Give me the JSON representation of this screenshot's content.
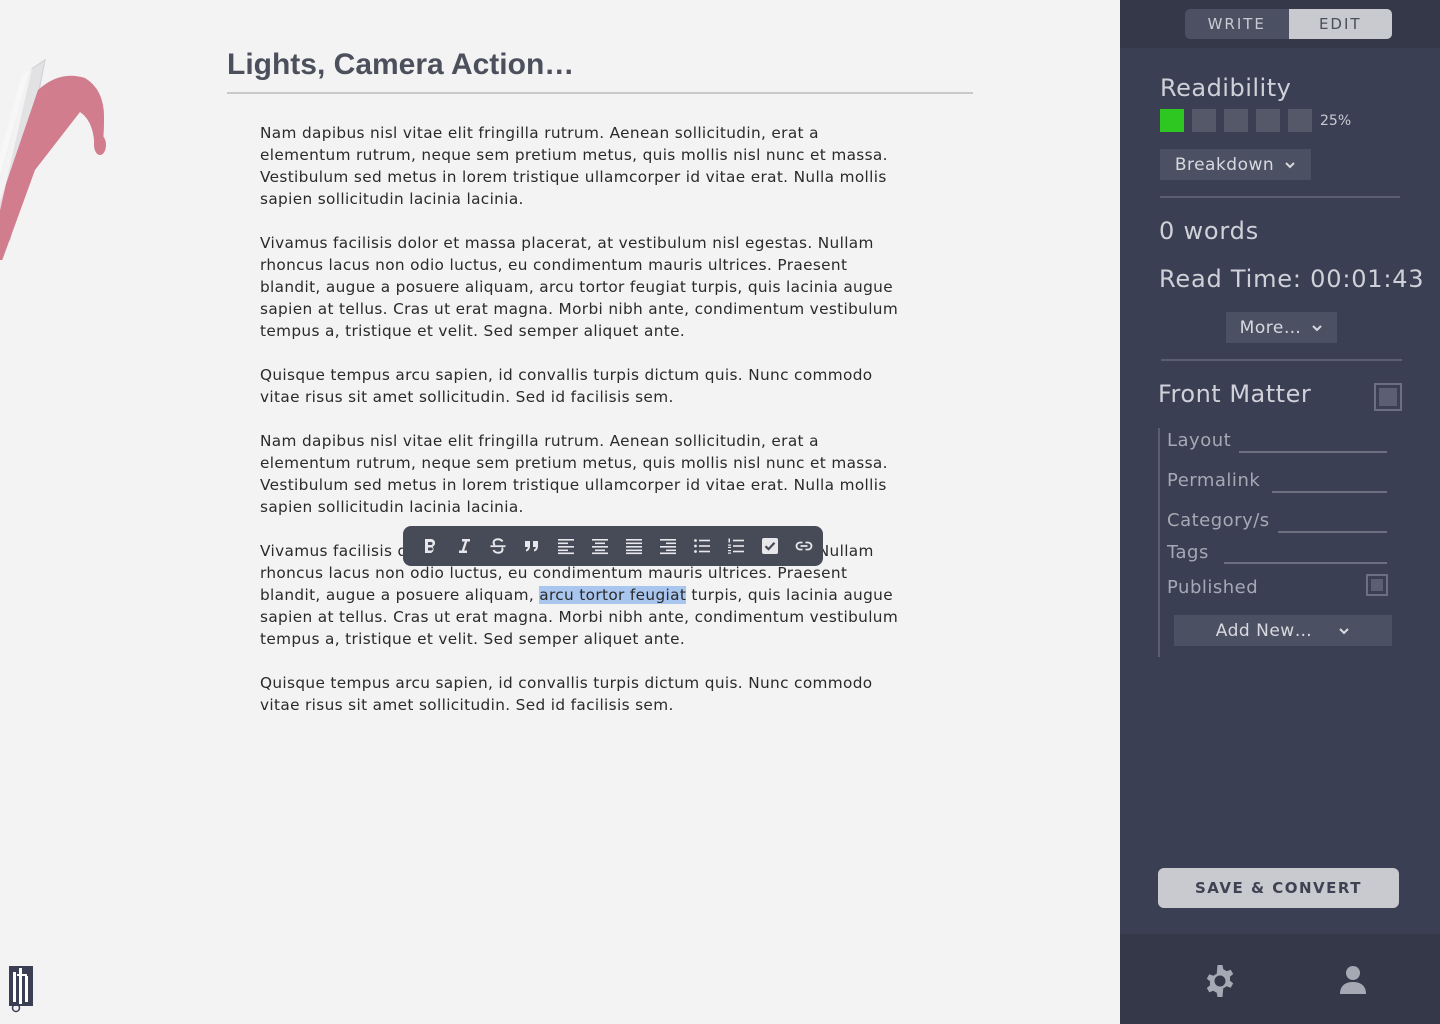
{
  "document": {
    "title": "Lights, Camera Action…",
    "paragraphs": [
      "Nam dapibus nisl vitae elit fringilla rutrum. Aenean sollicitudin, erat a elementum rutrum, neque sem pretium metus, quis mollis nisl nunc et massa. Vestibulum sed metus in lorem tristique ullamcorper id vitae erat. Nulla mollis sapien sollicitudin lacinia lacinia.",
      " Vivamus facilisis dolor et massa placerat, at vestibulum nisl egestas. Nullam rhoncus lacus non odio luctus, eu condimentum mauris ultrices. Praesent blandit, augue a posuere aliquam, arcu tortor feugiat turpis, quis lacinia augue sapien at tellus. Cras ut erat magna. Morbi nibh ante, condimentum vestibulum tempus a, tristique et velit. Sed semper aliquet ante.",
      "Quisque tempus arcu sapien, id convallis turpis dictum quis. Nunc commodo vitae risus sit amet sollicitudin. Sed id facilisis sem.",
      "Nam dapibus nisl vitae elit fringilla rutrum. Aenean sollicitudin, erat a elementum rutrum, neque sem pretium metus, quis mollis nisl nunc et massa. Vestibulum sed metus in lorem tristique ullamcorper id vitae erat. Nulla mollis sapien sollicitudin lacinia lacinia."
    ],
    "selected_paragraph": {
      "before": " Vivamus facilisis dolor et massa placerat, at vestibulum nisl egestas. Nullam rhoncus lacus non odio luctus, eu condimentum mauris ultrices. Praesent blandit, augue a posuere aliquam, ",
      "selected": "arcu tortor feugiat",
      "after": " turpis, quis lacinia augue sapien at tellus. Cras ut erat magna. Morbi nibh ante, condimentum vestibulum tempus a, tristique et velit. Sed semper aliquet ante."
    },
    "last_paragraph": "Quisque tempus arcu sapien, id convallis turpis dictum quis. Nunc commodo vitae risus sit amet sollicitudin. Sed id facilisis sem."
  },
  "format_toolbar": {
    "icons": [
      "bold-icon",
      "italic-icon",
      "strikethrough-icon",
      "quote-icon",
      "align-left-icon",
      "align-center-icon",
      "align-justify-icon",
      "align-right-icon",
      "bullet-list-icon",
      "numbered-list-icon",
      "checkbox-icon",
      "link-icon"
    ]
  },
  "sidebar": {
    "mode_toggle": {
      "write": "WRITE",
      "edit": "EDIT",
      "active": "edit"
    },
    "readability": {
      "heading": "Readibility",
      "level_fraction": 0.25,
      "percent_label": "25%",
      "active_color": "#2ec721",
      "breakdown_label": "Breakdown"
    },
    "word_count": "0 words",
    "read_time": "Read Time: 00:01:43",
    "more_label": "More…",
    "front_matter": {
      "heading": "Front Matter",
      "fields": [
        {
          "label": "Layout",
          "value": ""
        },
        {
          "label": "Permalink",
          "value": ""
        },
        {
          "label": "Category/s",
          "value": ""
        },
        {
          "label": "Tags",
          "value": ""
        }
      ],
      "published_label": "Published",
      "add_new_label": "Add New…"
    },
    "save_label": "SAVE & CONVERT",
    "bottom_icons": [
      "gear-icon",
      "user-icon"
    ]
  },
  "colors": {
    "sidebar_bg": "#3b3f54",
    "sidebar_dark": "#343849",
    "toolbar_bg": "#474a57",
    "selection": "#a9c6ee",
    "title": "#4c4f5c"
  }
}
